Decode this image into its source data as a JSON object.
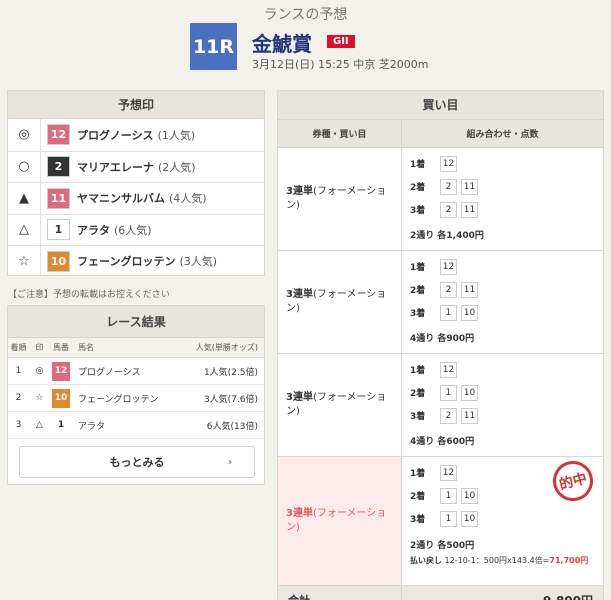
{
  "header": {
    "title": "ランスの予想",
    "race_number": "11R",
    "race_name": "金鯱賞",
    "grade": "GII",
    "meta": "3月12日(日) 15:25 中京 芝2000m"
  },
  "yoso": {
    "title": "予想印",
    "rows": [
      {
        "mark": "◎",
        "no": "12",
        "name": "プログノーシス",
        "pop": "(1人気)",
        "color": "#e06a7d",
        "text": "#fff"
      },
      {
        "mark": "○",
        "no": "2",
        "name": "マリアエレーナ",
        "pop": "(2人気)",
        "color": "#333333",
        "text": "#fff"
      },
      {
        "mark": "▲",
        "no": "11",
        "name": "ヤマニンサルバム",
        "pop": "(4人気)",
        "color": "#e06a7d",
        "text": "#fff"
      },
      {
        "mark": "△",
        "no": "1",
        "name": "アラタ",
        "pop": "(6人気)",
        "color": "#ffffff",
        "text": "#333"
      },
      {
        "mark": "☆",
        "no": "10",
        "name": "フェーングロッテン",
        "pop": "(3人気)",
        "color": "#e08a2e",
        "text": "#fff"
      }
    ]
  },
  "notice": "【ご注意】予想の転載はお控えください",
  "result": {
    "title": "レース結果",
    "headers": {
      "rank": "着順",
      "mark": "印",
      "no": "馬番",
      "name": "馬名",
      "pop": "人気(単勝オッズ)"
    },
    "rows": [
      {
        "rank": "1",
        "mark": "◎",
        "no": "12",
        "name": "プログノーシス",
        "pop": "1人気(2.5倍)",
        "color": "#e06a7d",
        "text": "#fff"
      },
      {
        "rank": "2",
        "mark": "☆",
        "no": "10",
        "name": "フェーングロッテン",
        "pop": "3人気(7.6倍)",
        "color": "#e08a2e",
        "text": "#fff"
      },
      {
        "rank": "3",
        "mark": "△",
        "no": "1",
        "name": "アラタ",
        "pop": "6人気(13倍)",
        "color": "#ffffff",
        "text": "#333"
      }
    ],
    "more_label": "もっとみる"
  },
  "kaime": {
    "title": "買い目",
    "col_a": "券種・買い目",
    "col_b": "組み合わせ・点数",
    "blocks": [
      {
        "bet": "3連単",
        "type": "(フォーメーション)",
        "first": [
          "12"
        ],
        "second": [
          "2",
          "11"
        ],
        "third": [
          "2",
          "11"
        ],
        "summary": "2通り 各1,400円"
      },
      {
        "bet": "3連単",
        "type": "(フォーメーション)",
        "first": [
          "12"
        ],
        "second": [
          "2",
          "11"
        ],
        "third": [
          "1",
          "10"
        ],
        "summary": "4通り 各900円"
      },
      {
        "bet": "3連単",
        "type": "(フォーメーション)",
        "first": [
          "12"
        ],
        "second": [
          "1",
          "10"
        ],
        "third": [
          "2",
          "11"
        ],
        "summary": "4通り 各600円"
      },
      {
        "bet": "3連単",
        "type": "(フォーメーション)",
        "first": [
          "12"
        ],
        "second": [
          "1",
          "10"
        ],
        "third": [
          "1",
          "10"
        ],
        "summary": "2通り 各500円",
        "hit": true,
        "stamp": "的中",
        "payout_label": "払い戻し",
        "payout_text": "12-10-1：500円x143.4倍=",
        "payout_amount": "71,700円"
      }
    ],
    "labels": {
      "first": "1着",
      "second": "2着",
      "third": "3着"
    },
    "total_label": "合計",
    "total_value": "9,800円"
  }
}
